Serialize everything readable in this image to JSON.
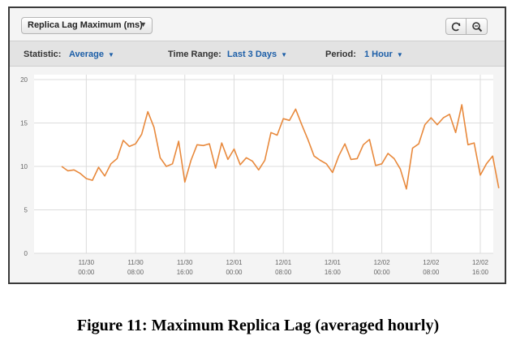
{
  "toolbar": {
    "metric_label": "Replica Lag Maximum (ms)",
    "statistic_label": "Statistic:",
    "statistic_value": "Average",
    "time_range_label": "Time Range:",
    "time_range_value": "Last 3 Days",
    "period_label": "Period:",
    "period_value": "1 Hour",
    "refresh_icon": "refresh-icon",
    "zoom_icon": "zoom-icon"
  },
  "caption": "Figure 11: Maximum Replica Lag (averaged hourly)",
  "colors": {
    "line": "#e8893c",
    "grid": "#dcdcdc",
    "link": "#1d5fa8"
  },
  "chart_data": {
    "type": "line",
    "ylim": [
      0,
      20
    ],
    "yticks": [
      0,
      5,
      10,
      15,
      20
    ],
    "xlim": [
      0,
      68
    ],
    "xticks": [
      {
        "x": 4,
        "date": "11/30",
        "time": "00:00"
      },
      {
        "x": 12,
        "date": "11/30",
        "time": "08:00"
      },
      {
        "x": 20,
        "date": "11/30",
        "time": "16:00"
      },
      {
        "x": 28,
        "date": "12/01",
        "time": "00:00"
      },
      {
        "x": 36,
        "date": "12/01",
        "time": "08:00"
      },
      {
        "x": 44,
        "date": "12/01",
        "time": "16:00"
      },
      {
        "x": 52,
        "date": "12/02",
        "time": "00:00"
      },
      {
        "x": 60,
        "date": "12/02",
        "time": "08:00"
      },
      {
        "x": 68,
        "date": "12/02",
        "time": "16:00"
      }
    ],
    "grid": true,
    "series": [
      {
        "x": [
          0,
          1,
          2,
          3,
          4,
          5,
          6,
          7,
          8,
          9,
          10,
          11,
          12,
          13,
          14,
          15,
          16,
          17,
          18,
          19,
          20,
          21,
          22,
          23,
          24,
          25,
          26,
          27,
          28,
          29,
          30,
          31,
          32,
          33,
          34,
          35,
          36,
          37,
          38,
          39,
          40,
          41,
          42,
          43,
          44,
          45,
          46,
          47,
          48,
          49,
          50,
          51,
          52,
          53,
          54,
          55,
          56,
          57,
          58,
          59,
          60,
          61,
          62,
          63,
          64,
          65,
          66,
          67,
          68,
          69,
          70,
          71
        ],
        "values": [
          10.0,
          9.5,
          9.6,
          9.2,
          8.6,
          8.4,
          9.9,
          8.9,
          10.3,
          10.9,
          13.0,
          12.3,
          12.6,
          13.7,
          16.3,
          14.5,
          11.0,
          10.0,
          10.3,
          12.9,
          8.2,
          10.7,
          12.5,
          12.4,
          12.6,
          9.8,
          12.7,
          10.8,
          12.0,
          10.2,
          11.0,
          10.6,
          9.6,
          10.7,
          13.9,
          13.6,
          15.5,
          15.3,
          16.6,
          14.8,
          13.1,
          11.2,
          10.7,
          10.3,
          9.3,
          11.2,
          12.6,
          10.8,
          10.9,
          12.5,
          13.1,
          10.1,
          10.3,
          11.5,
          10.9,
          9.7,
          7.4,
          12.1,
          12.6,
          14.8,
          15.6,
          14.8,
          15.6,
          16.0,
          13.9,
          17.1,
          12.5,
          12.7,
          9.0,
          10.3,
          11.2,
          7.5
        ]
      }
    ]
  }
}
